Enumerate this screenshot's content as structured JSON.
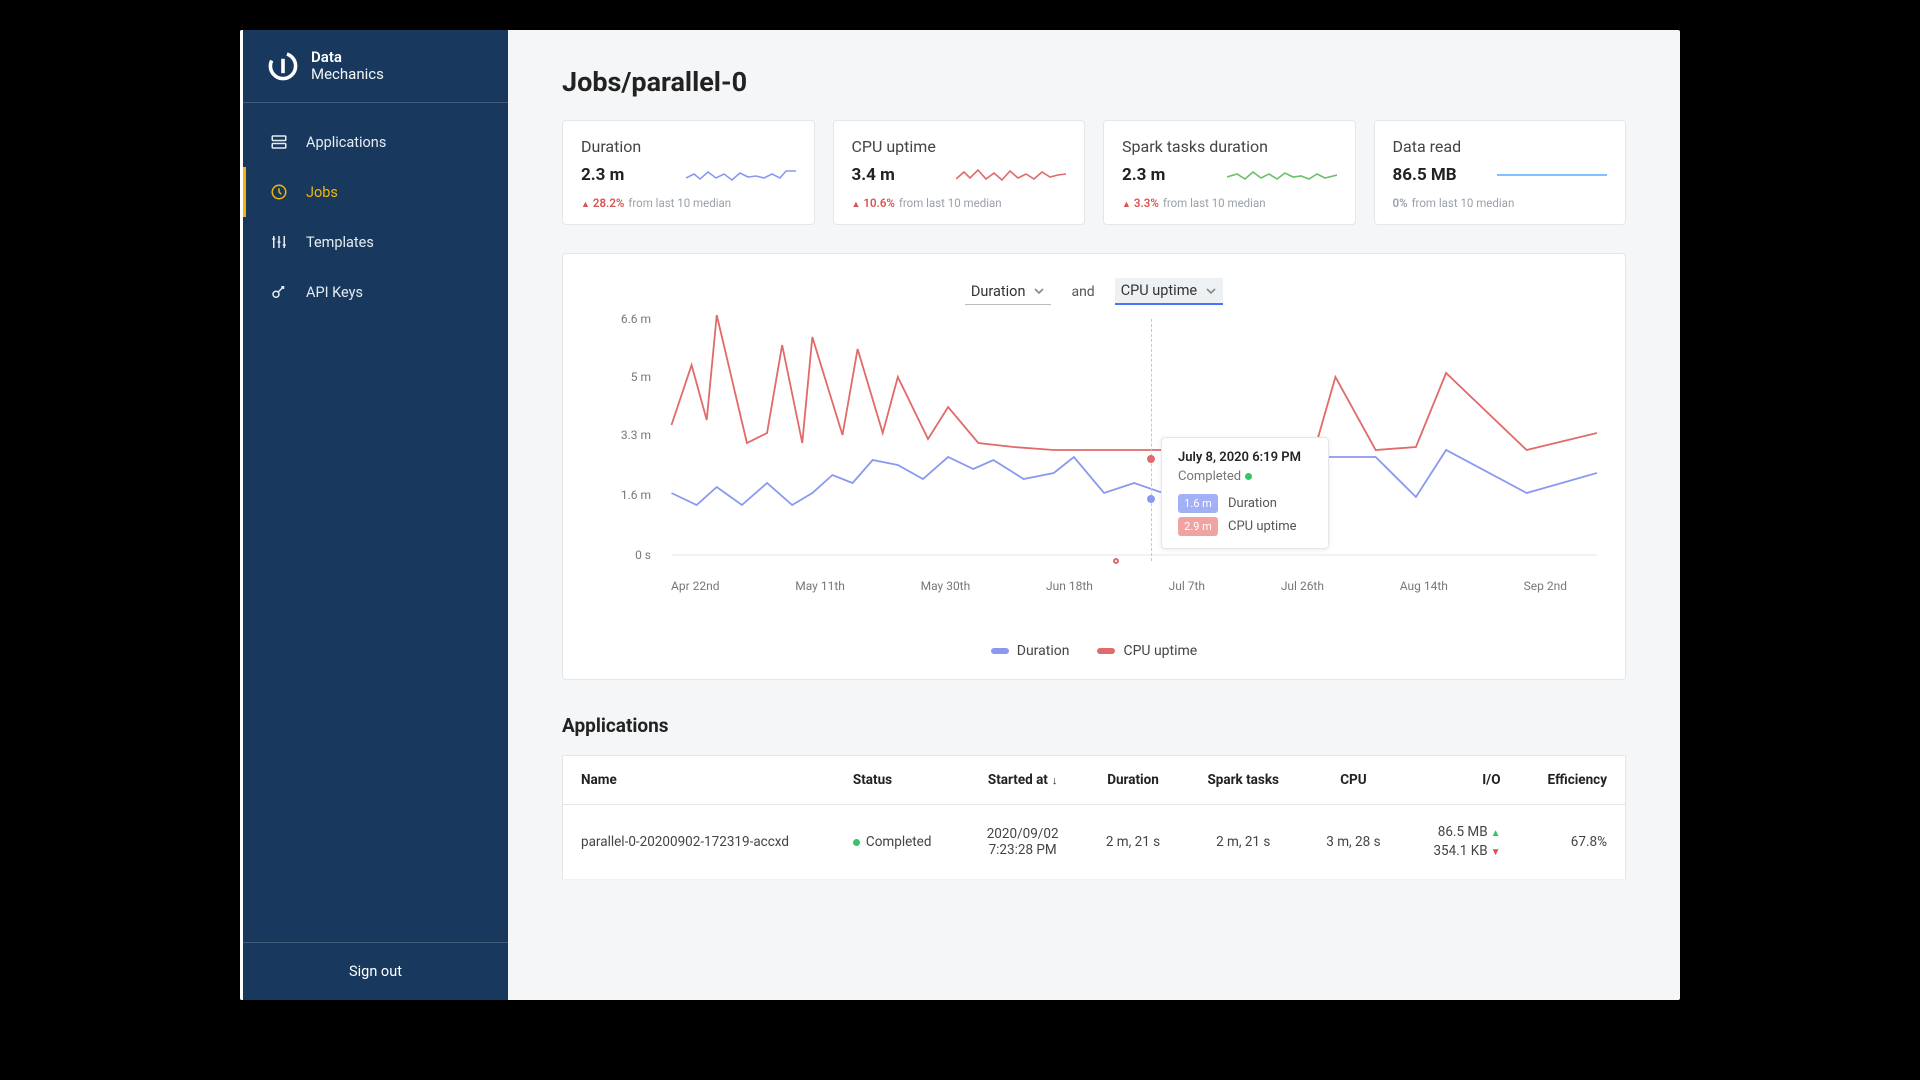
{
  "brand": {
    "line1": "Data",
    "line2": "Mechanics"
  },
  "sidebar": {
    "items": [
      {
        "label": "Applications"
      },
      {
        "label": "Jobs"
      },
      {
        "label": "Templates"
      },
      {
        "label": "API Keys"
      }
    ],
    "signout": "Sign out"
  },
  "page": {
    "title": "Jobs/parallel-0"
  },
  "cards": [
    {
      "title": "Duration",
      "value": "2.3 m",
      "delta": "28.2%",
      "delta_kind": "up",
      "suffix": "from last 10 median",
      "spark_color": "#8a99f0"
    },
    {
      "title": "CPU uptime",
      "value": "3.4 m",
      "delta": "10.6%",
      "delta_kind": "up",
      "suffix": "from last 10 median",
      "spark_color": "#e16a6a"
    },
    {
      "title": "Spark tasks duration",
      "value": "2.3 m",
      "delta": "3.3%",
      "delta_kind": "up",
      "suffix": "from last 10 median",
      "spark_color": "#6bbf6b"
    },
    {
      "title": "Data read",
      "value": "86.5 MB",
      "delta": "0%",
      "delta_kind": "flat",
      "suffix": "from last 10 median",
      "spark_color": "#6fb7ff"
    }
  ],
  "chart_selectors": {
    "a": "Duration",
    "and": "and",
    "b": "CPU uptime"
  },
  "tooltip": {
    "date": "July 8, 2020 6:19 PM",
    "status": "Completed",
    "rows": [
      {
        "badge": "1.6 m",
        "color": "blue",
        "label": "Duration"
      },
      {
        "badge": "2.9 m",
        "color": "red",
        "label": "CPU uptime"
      }
    ]
  },
  "legend": [
    {
      "label": "Duration",
      "color": "blue"
    },
    {
      "label": "CPU uptime",
      "color": "red"
    }
  ],
  "applications": {
    "heading": "Applications",
    "columns": [
      "Name",
      "Status",
      "Started at",
      "Duration",
      "Spark tasks",
      "CPU",
      "I/O",
      "Efficiency"
    ],
    "sort_col": "Started at",
    "rows": [
      {
        "name": "parallel-0-20200902-172319-accxd",
        "status": "Completed",
        "started_at_line1": "2020/09/02",
        "started_at_line2": "7:23:28 PM",
        "duration": "2 m, 21 s",
        "spark_tasks": "2 m, 21 s",
        "cpu": "3 m, 28 s",
        "io_line1": "86.5 MB",
        "io_line2": "354.1 KB",
        "efficiency": "67.8%"
      }
    ]
  },
  "chart_data": {
    "type": "line",
    "title": "",
    "xlabel": "",
    "ylabel": "",
    "ylim": [
      0,
      6.6
    ],
    "y_ticks": [
      "6.6 m",
      "5 m",
      "3.3 m",
      "1.6 m",
      "0 s"
    ],
    "x_ticks": [
      "Apr 22nd",
      "May 11th",
      "May 30th",
      "Jun 18th",
      "Jul 7th",
      "Jul 26th",
      "Aug 14th",
      "Sep 2nd"
    ],
    "series": [
      {
        "name": "Duration",
        "color": "#8a99f0",
        "values": [
          1.7,
          1.4,
          1.9,
          1.4,
          2.0,
          1.4,
          1.7,
          2.2,
          2.0,
          2.6,
          2.5,
          2.1,
          2.7,
          2.4,
          2.6,
          2.1,
          2.3,
          2.7,
          1.7,
          2.0,
          1.6,
          1.6,
          1.4,
          1.0,
          2.7,
          2.7,
          1.6,
          2.9,
          1.7,
          2.3
        ]
      },
      {
        "name": "CPU uptime",
        "color": "#e16a6a",
        "values": [
          3.6,
          5.2,
          3.7,
          6.6,
          3.1,
          3.4,
          5.8,
          3.1,
          6.0,
          3.3,
          5.7,
          3.4,
          4.9,
          3.2,
          4.1,
          3.1,
          3.0,
          2.9,
          2.9,
          2.9,
          2.9,
          2.9,
          2.9,
          3.0,
          4.9,
          2.9,
          3.0,
          5.0,
          2.9,
          3.4
        ]
      }
    ],
    "hover_point": {
      "x_label": "Jul 7th",
      "duration": "1.6 m",
      "cpu_uptime": "2.9 m"
    }
  }
}
